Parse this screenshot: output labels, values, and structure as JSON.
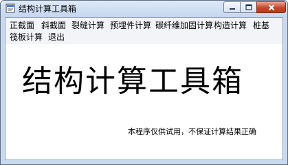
{
  "window": {
    "title": "结构计算工具箱",
    "buttons": {
      "minimize": "minimize-icon",
      "maximize": "maximize-icon",
      "close": "close-icon"
    }
  },
  "menu": {
    "items": [
      "正截面",
      "斜截面",
      "裂缝计算",
      "预埋件计算",
      "碳纤维加固计算",
      "构造计算",
      "桩基",
      "筏板计算",
      "退出"
    ]
  },
  "main": {
    "title": "结构计算工具箱",
    "note": "本程序仅供试用，不保证计算结果正确"
  },
  "colors": {
    "close_button": "#c7452b",
    "frame": "#c9d9ee"
  }
}
